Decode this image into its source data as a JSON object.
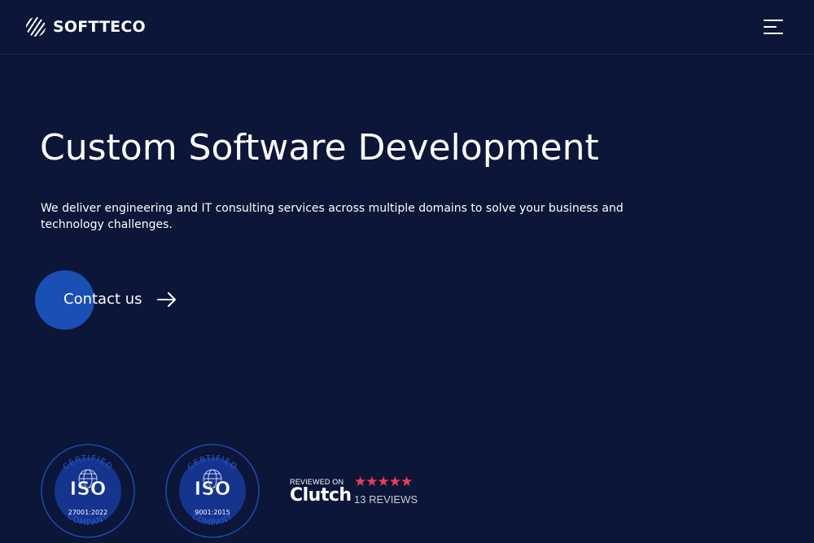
{
  "header": {
    "brand": "SOFTTECO",
    "logo_icon": "softteco-logo-icon",
    "menu_icon": "hamburger-menu-icon"
  },
  "hero": {
    "title": "Custom Software Development",
    "description": "We deliver engineering and IT consulting services across multiple domains to solve your business and technology challenges."
  },
  "cta": {
    "label": "Contact us",
    "icon": "arrow-right-icon"
  },
  "badges": [
    {
      "top_text": "CERTIFIED",
      "mark": "ISO",
      "standard": "27001:2022",
      "bottom_text": "COMPANY"
    },
    {
      "top_text": "CERTIFIED",
      "mark": "ISO",
      "standard": "9001:2015",
      "bottom_text": "COMPANY"
    }
  ],
  "clutch": {
    "reviewed_on": "REVIEWED ON",
    "brand": "Clutch",
    "stars": "★★★★★",
    "reviews": "13 REVIEWS"
  },
  "colors": {
    "background": "#0b1638",
    "cta_circle": "#1a4fb4",
    "badge_ring": "#1f46a8",
    "star_color": "#ef3b5a"
  }
}
